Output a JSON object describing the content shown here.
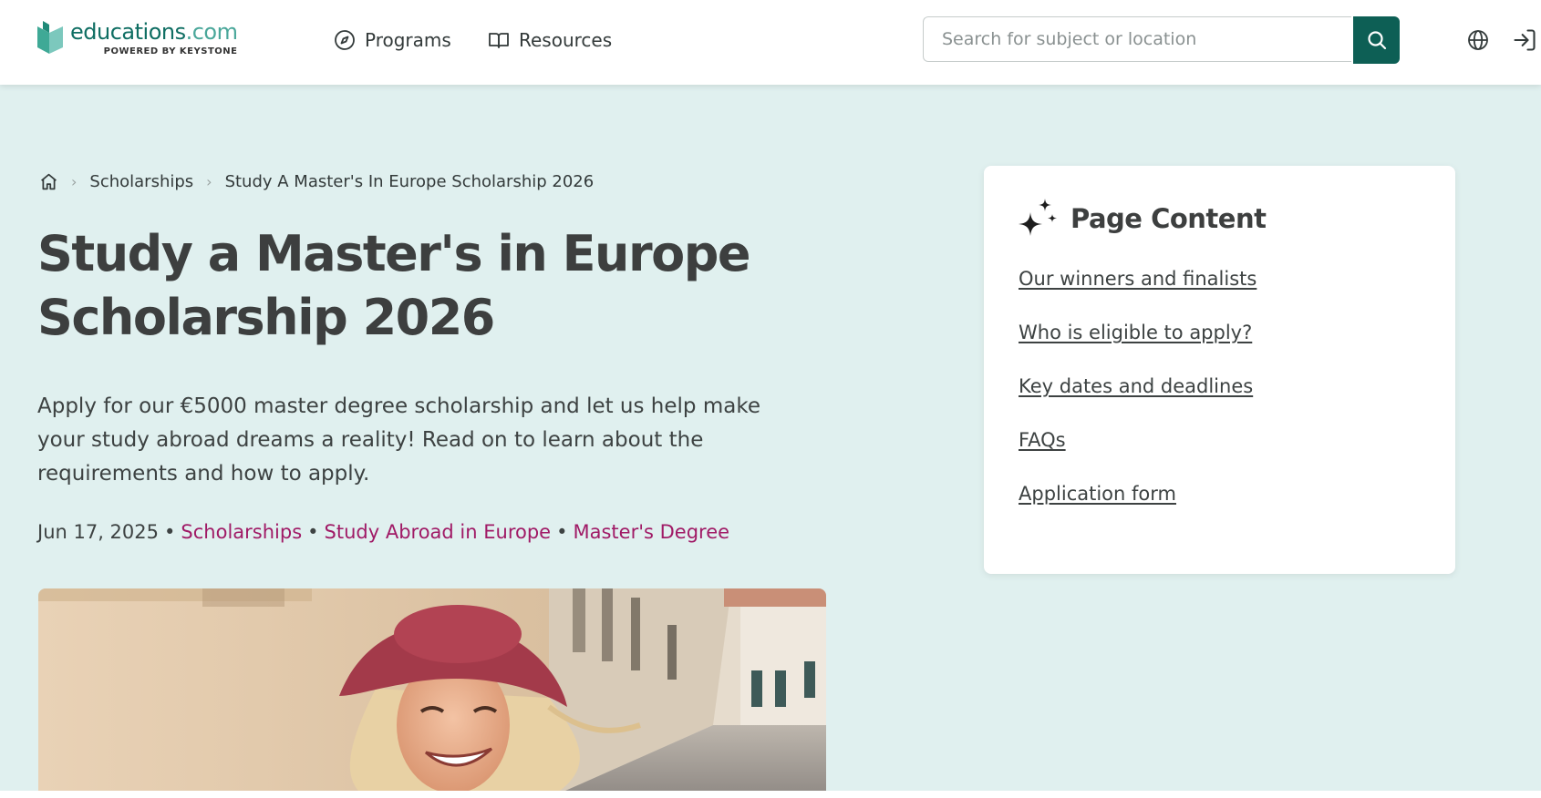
{
  "header": {
    "logo": {
      "word_main": "educations",
      "word_tld": ".com",
      "tagline": "POWERED BY KEYSTONE"
    },
    "nav": {
      "programs_label": "Programs",
      "resources_label": "Resources"
    },
    "search": {
      "placeholder": "Search for subject or location",
      "value": ""
    }
  },
  "breadcrumb": {
    "items": [
      "Scholarships",
      "Study A Master's In Europe Scholarship 2026"
    ]
  },
  "hero": {
    "title": "Study a Master's in Europe Scholarship 2026",
    "intro": "Apply for our €5000 master degree scholarship and let us help make your study abroad dreams a reality! Read on to learn about the requirements and how to apply.",
    "date": "Jun 17, 2025",
    "separator": "•",
    "tags": [
      "Scholarships",
      "Study Abroad in Europe",
      "Master's Degree"
    ]
  },
  "toc": {
    "title": "Page Content",
    "links": [
      "Our winners and finalists",
      "Who is eligible to apply?",
      "Key dates and deadlines",
      "FAQs",
      "Application form"
    ]
  },
  "icons": {
    "logo": "book-logo-icon",
    "programs": "compass-icon",
    "resources": "open-book-icon",
    "search": "search-icon",
    "language": "globe-icon",
    "login": "login-icon",
    "home": "home-icon",
    "breadcrumb_separator": "chevron-right-icon",
    "toc": "sparkles-icon"
  },
  "colors": {
    "brand_teal": "#0d5f55",
    "hero_background": "#e0f0ef",
    "tag_magenta": "#a01a66",
    "heading": "#3d3f3f"
  }
}
